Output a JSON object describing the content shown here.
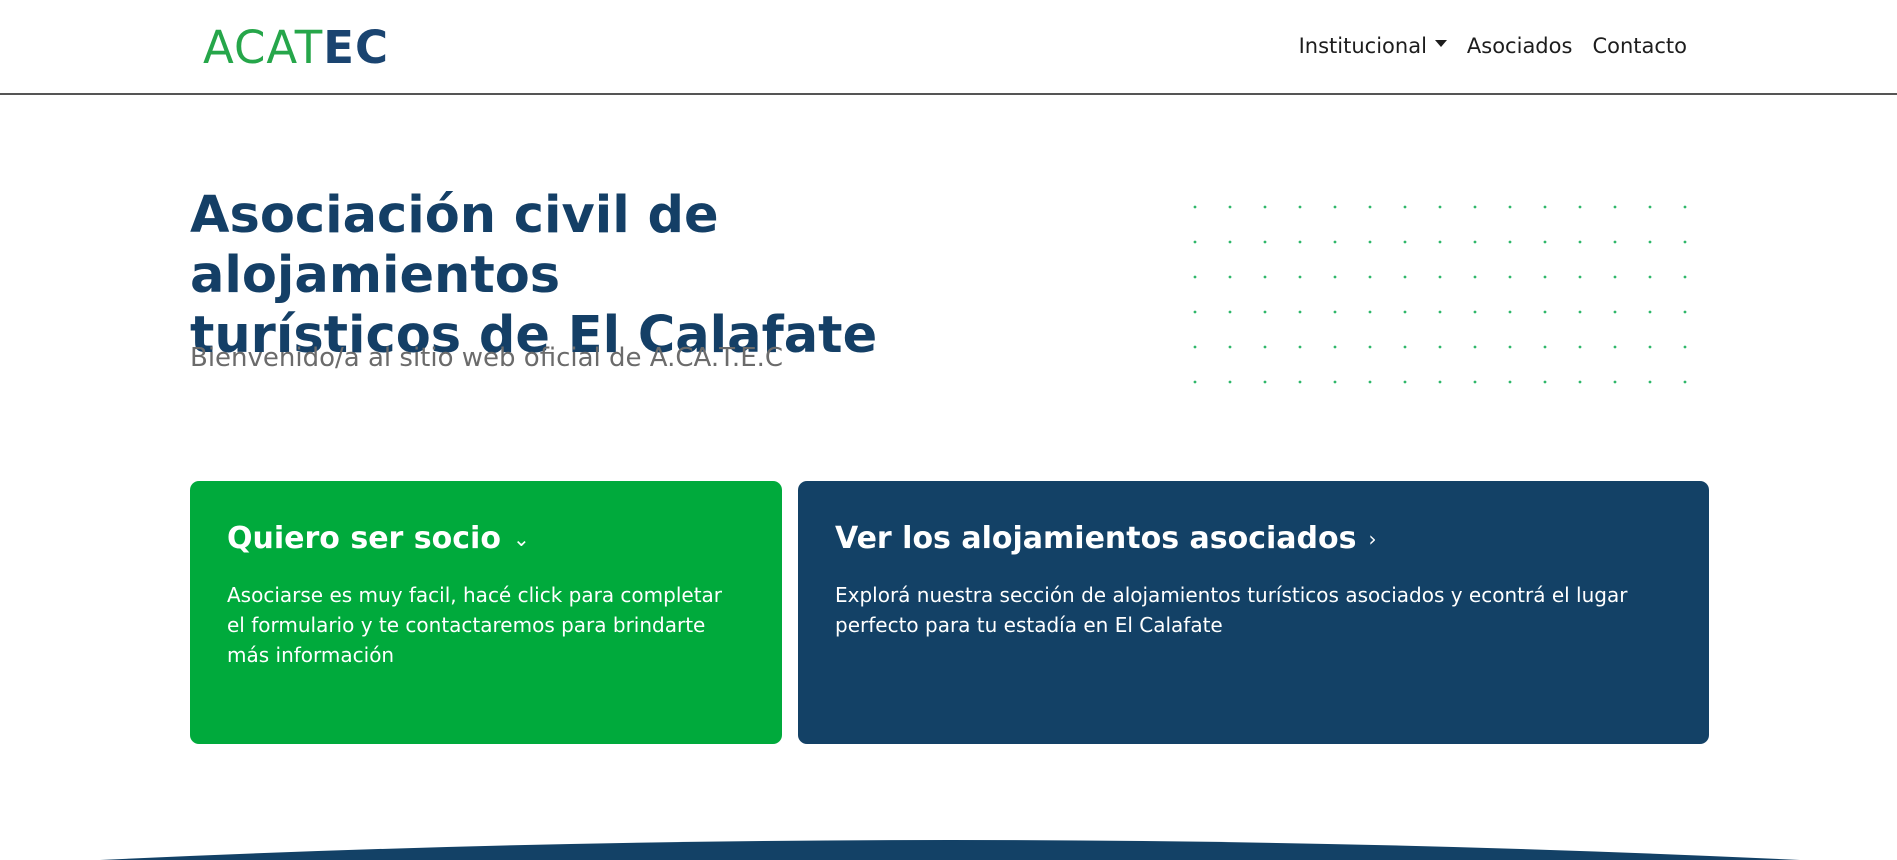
{
  "header": {
    "logo_part1": "ACAT",
    "logo_part2": "EC",
    "nav": [
      {
        "label": "Institucional"
      },
      {
        "label": "Asociados"
      },
      {
        "label": "Contacto"
      }
    ]
  },
  "hero": {
    "title_line1": "Asociación civil de alojamientos",
    "title_line2": "turísticos de El Calafate",
    "subtitle": "Bienvenido/a al sitio web oficial de A.CA.T.E.C"
  },
  "cards": [
    {
      "title": "Quiero ser socio",
      "chevron": "⌄",
      "text": "Asociarse es muy facil, hacé click para completar el formulario y te contactaremos para brindarte más información"
    },
    {
      "title": "Ver los alojamientos asociados",
      "chevron": "›",
      "text": "Explorá nuestra sección de alojamientos turísticos asociados y econtrá el lugar perfecto para tu estadía en El Calafate"
    }
  ],
  "colors": {
    "primary_blue": "#134166",
    "green": "#00aa3c",
    "logo_green": "#26a64a"
  }
}
